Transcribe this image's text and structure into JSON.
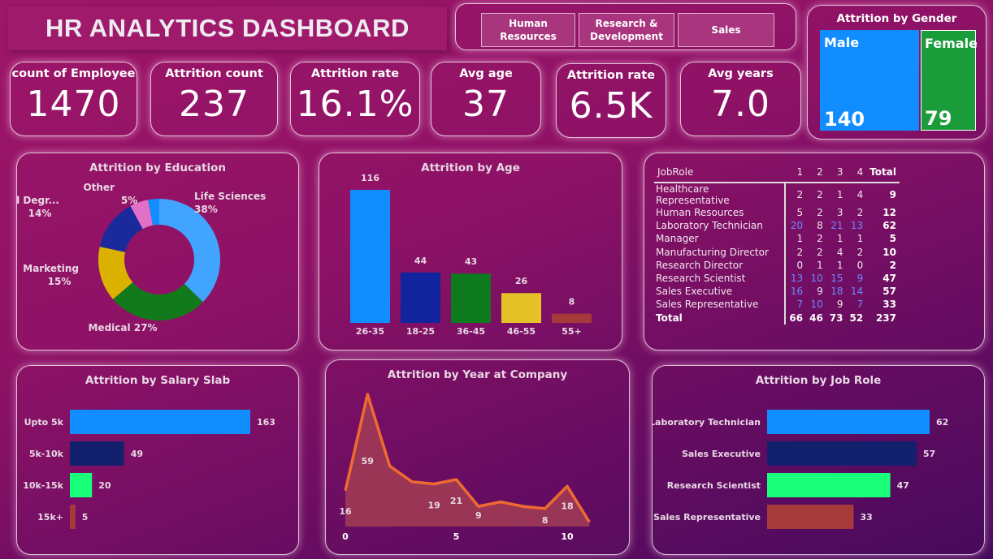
{
  "header": {
    "title": "HR ANALYTICS DASHBOARD"
  },
  "slicer": {
    "options": [
      "Human Resources",
      "Research & Development",
      "Sales"
    ]
  },
  "kpis": [
    {
      "label": "count of Employee",
      "value": "1470"
    },
    {
      "label": "Attrition count",
      "value": "237"
    },
    {
      "label": "Attrition rate",
      "value": "16.1%"
    },
    {
      "label": "Avg age",
      "value": "37"
    },
    {
      "label": "Attrition rate",
      "value": "6.5K"
    },
    {
      "label": "Avg years",
      "value": "7.0"
    }
  ],
  "gender": {
    "title": "Attrition by Gender",
    "male_label": "Male",
    "male_value": "140",
    "female_label": "Female",
    "female_value": "79",
    "colors": {
      "male": "#118dff",
      "female": "#1a9c3a"
    }
  },
  "chart_data": [
    {
      "type": "pie",
      "title": "Attrition by Education",
      "donut": true,
      "slices": [
        {
          "label": "Life Sciences",
          "pct_label": "38%",
          "value": 38,
          "color": "#41a4ff"
        },
        {
          "label": "Medical",
          "pct_label": "27%",
          "value": 27,
          "color": "#127a1a"
        },
        {
          "label": "Marketing",
          "pct_label": "15%",
          "value": 15,
          "color": "#dcb200"
        },
        {
          "label": "Technical Degr...",
          "pct_label": "14%",
          "value": 14,
          "color": "#1a2a9c"
        },
        {
          "label": "Other",
          "pct_label": "5%",
          "value": 5,
          "color": "#e070c8"
        },
        {
          "label": "",
          "pct_label": "",
          "value": 3,
          "color": "#118dff"
        }
      ]
    },
    {
      "type": "bar",
      "title": "Attrition by Age",
      "categories": [
        "26-35",
        "18-25",
        "36-45",
        "46-55",
        "55+"
      ],
      "values": [
        116,
        44,
        43,
        26,
        8
      ],
      "colors": [
        "#118dff",
        "#12239e",
        "#0e7a1e",
        "#e6c229",
        "#a63a3a"
      ]
    },
    {
      "type": "bar",
      "orientation": "horizontal",
      "title": "Attrition by Salary Slab",
      "categories": [
        "Upto 5k",
        "5k-10k",
        "10k-15k",
        "15k+"
      ],
      "values": [
        163,
        49,
        20,
        5
      ],
      "colors": [
        "#118dff",
        "#12206e",
        "#1aff7a",
        "#a63a3a"
      ]
    },
    {
      "type": "area",
      "title": "Attrition by Year at Company",
      "x": [
        0,
        1,
        2,
        3,
        4,
        5,
        6,
        7,
        8,
        9,
        10,
        11
      ],
      "values": [
        16,
        59,
        27,
        20,
        19,
        21,
        9,
        11,
        9,
        8,
        18,
        2
      ],
      "data_labels": [
        {
          "x": 0,
          "text": "16"
        },
        {
          "x": 1,
          "text": "59"
        },
        {
          "x": 4,
          "text": "19"
        },
        {
          "x": 5,
          "text": "21"
        },
        {
          "x": 6,
          "text": "9"
        },
        {
          "x": 9,
          "text": "8"
        },
        {
          "x": 10,
          "text": "18"
        }
      ],
      "xticks": [
        "0",
        "5",
        "10"
      ],
      "line_color": "#ee6a30",
      "fill_color": "#a03a55"
    },
    {
      "type": "bar",
      "orientation": "horizontal",
      "title": "Attrition by Job Role",
      "categories": [
        "Laboratory Technician",
        "Sales Executive",
        "Research Scientist",
        "Sales Representative"
      ],
      "values": [
        62,
        57,
        47,
        33
      ],
      "colors": [
        "#118dff",
        "#12206e",
        "#1aff7a",
        "#a63a3a"
      ]
    },
    {
      "type": "table",
      "columns": [
        "JobRole",
        "1",
        "2",
        "3",
        "4",
        "Total"
      ],
      "rows": [
        [
          "Healthcare Representative",
          "2",
          "2",
          "1",
          "4",
          "9"
        ],
        [
          "Human Resources",
          "5",
          "2",
          "3",
          "2",
          "12"
        ],
        [
          "Laboratory Technician",
          "20",
          "8",
          "21",
          "13",
          "62"
        ],
        [
          "Manager",
          "1",
          "2",
          "1",
          "1",
          "5"
        ],
        [
          "Manufacturing Director",
          "2",
          "2",
          "4",
          "2",
          "10"
        ],
        [
          "Research Director",
          "0",
          "1",
          "1",
          "0",
          "2"
        ],
        [
          "Research Scientist",
          "13",
          "10",
          "15",
          "9",
          "47"
        ],
        [
          "Sales Executive",
          "16",
          "9",
          "18",
          "14",
          "57"
        ],
        [
          "Sales Representative",
          "7",
          "10",
          "9",
          "7",
          "33"
        ]
      ],
      "total": [
        "Total",
        "66",
        "46",
        "73",
        "52",
        "237"
      ]
    }
  ]
}
